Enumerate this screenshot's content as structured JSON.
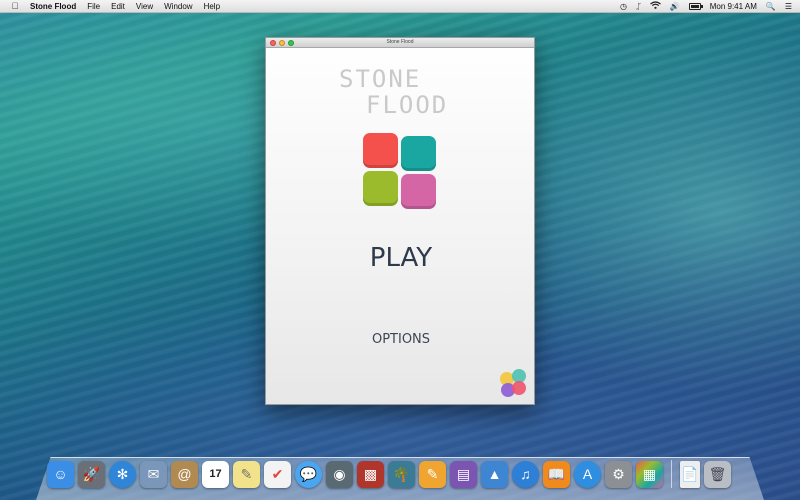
{
  "menubar": {
    "apple_icon": "apple-icon",
    "app_name": "Stone Flood",
    "items": [
      "File",
      "Edit",
      "View",
      "Window",
      "Help"
    ],
    "clock": "Mon 9:41 AM",
    "status_icons": [
      "time-machine-icon",
      "bluetooth-icon",
      "wifi-icon",
      "volume-icon",
      "battery-icon",
      "search-icon",
      "list-icon"
    ]
  },
  "window": {
    "title": "Stone Flood",
    "logo_line1": "STONE",
    "logo_line2": "FLOOD",
    "tile_colors": [
      "#f5514c",
      "#1aa7a2",
      "#9bbb2c",
      "#d466a6"
    ],
    "play_label": "PLAY",
    "options_label": "OPTIONS",
    "badge_icon": "game-center-icon"
  },
  "dock": {
    "calendar_day": "17",
    "apps": [
      {
        "name": "finder-icon",
        "color": "#3a8ee6"
      },
      {
        "name": "launchpad-icon",
        "color": "#6b6f78"
      },
      {
        "name": "safari-icon",
        "color": "#2f86d9"
      },
      {
        "name": "mail-icon",
        "color": "#7a96b8"
      },
      {
        "name": "contacts-icon",
        "color": "#b18a52"
      },
      {
        "name": "calendar-icon",
        "color": "#ffffff"
      },
      {
        "name": "notes-icon",
        "color": "#f2e28b"
      },
      {
        "name": "reminders-icon",
        "color": "#f3f3f3"
      },
      {
        "name": "messages-icon",
        "color": "#4aa6f0"
      },
      {
        "name": "facetime-icon",
        "color": "#5a6a72"
      },
      {
        "name": "photo-booth-icon",
        "color": "#b0352b"
      },
      {
        "name": "iphoto-icon",
        "color": "#3b7b95"
      },
      {
        "name": "pages-icon",
        "color": "#f0a531"
      },
      {
        "name": "numbers-icon",
        "color": "#7c55b2"
      },
      {
        "name": "keynote-icon",
        "color": "#3e86d1"
      },
      {
        "name": "itunes-icon",
        "color": "#2e7fd6"
      },
      {
        "name": "ibooks-icon",
        "color": "#f08a1d"
      },
      {
        "name": "app-store-icon",
        "color": "#2f8ee0"
      },
      {
        "name": "system-preferences-icon",
        "color": "#8c8f93"
      },
      {
        "name": "stone-flood-icon",
        "color": "#e95b4d"
      },
      {
        "name": "document-icon",
        "color": "#eeeeee"
      },
      {
        "name": "trash-icon",
        "color": "#b9bec4"
      }
    ]
  }
}
